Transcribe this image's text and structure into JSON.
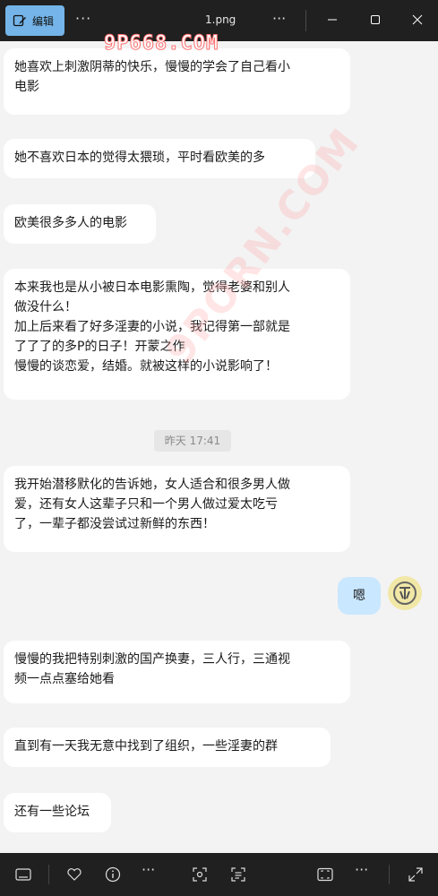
{
  "titlebar": {
    "edit_label": "编辑",
    "more": "···",
    "filename": "1.png",
    "more2": "···"
  },
  "watermark": {
    "top": "9P668.COM",
    "diagonal": "9PORN.COM"
  },
  "messages": [
    {
      "text": "她喜欢上刺激阴蒂的快乐，慢慢的学会了自己看小\n电影"
    },
    {
      "text": "她不喜欢日本的觉得太猥琐，平时看欧美的多"
    },
    {
      "text": "欧美很多多人的电影"
    },
    {
      "text": "本来我也是从小被日本电影熏陶，觉得老婆和别人\n做没什么！\n加上后来看了好多淫妻的小说，我记得第一部就是\n了了了的多P的日子！开蒙之作\n慢慢的谈恋爱，结婚。就被这样的小说影响了！"
    },
    {
      "text": "我开始潜移默化的告诉她，女人适合和很多男人做\n爱，还有女人这辈子只和一个男人做过爱太吃亏\n了，一辈子都没尝试过新鲜的东西！"
    },
    {
      "text": "慢慢的我把特别刺激的国产换妻，三人行，三通视\n频一点点塞给她看"
    },
    {
      "text": "直到有一天我无意中找到了组织，一些淫妻的群"
    },
    {
      "text": "还有一些论坛"
    }
  ],
  "timestamp": "昨天 17:41",
  "sent_message": "嗯",
  "bottombar": {
    "more": "···",
    "more2": "···"
  }
}
